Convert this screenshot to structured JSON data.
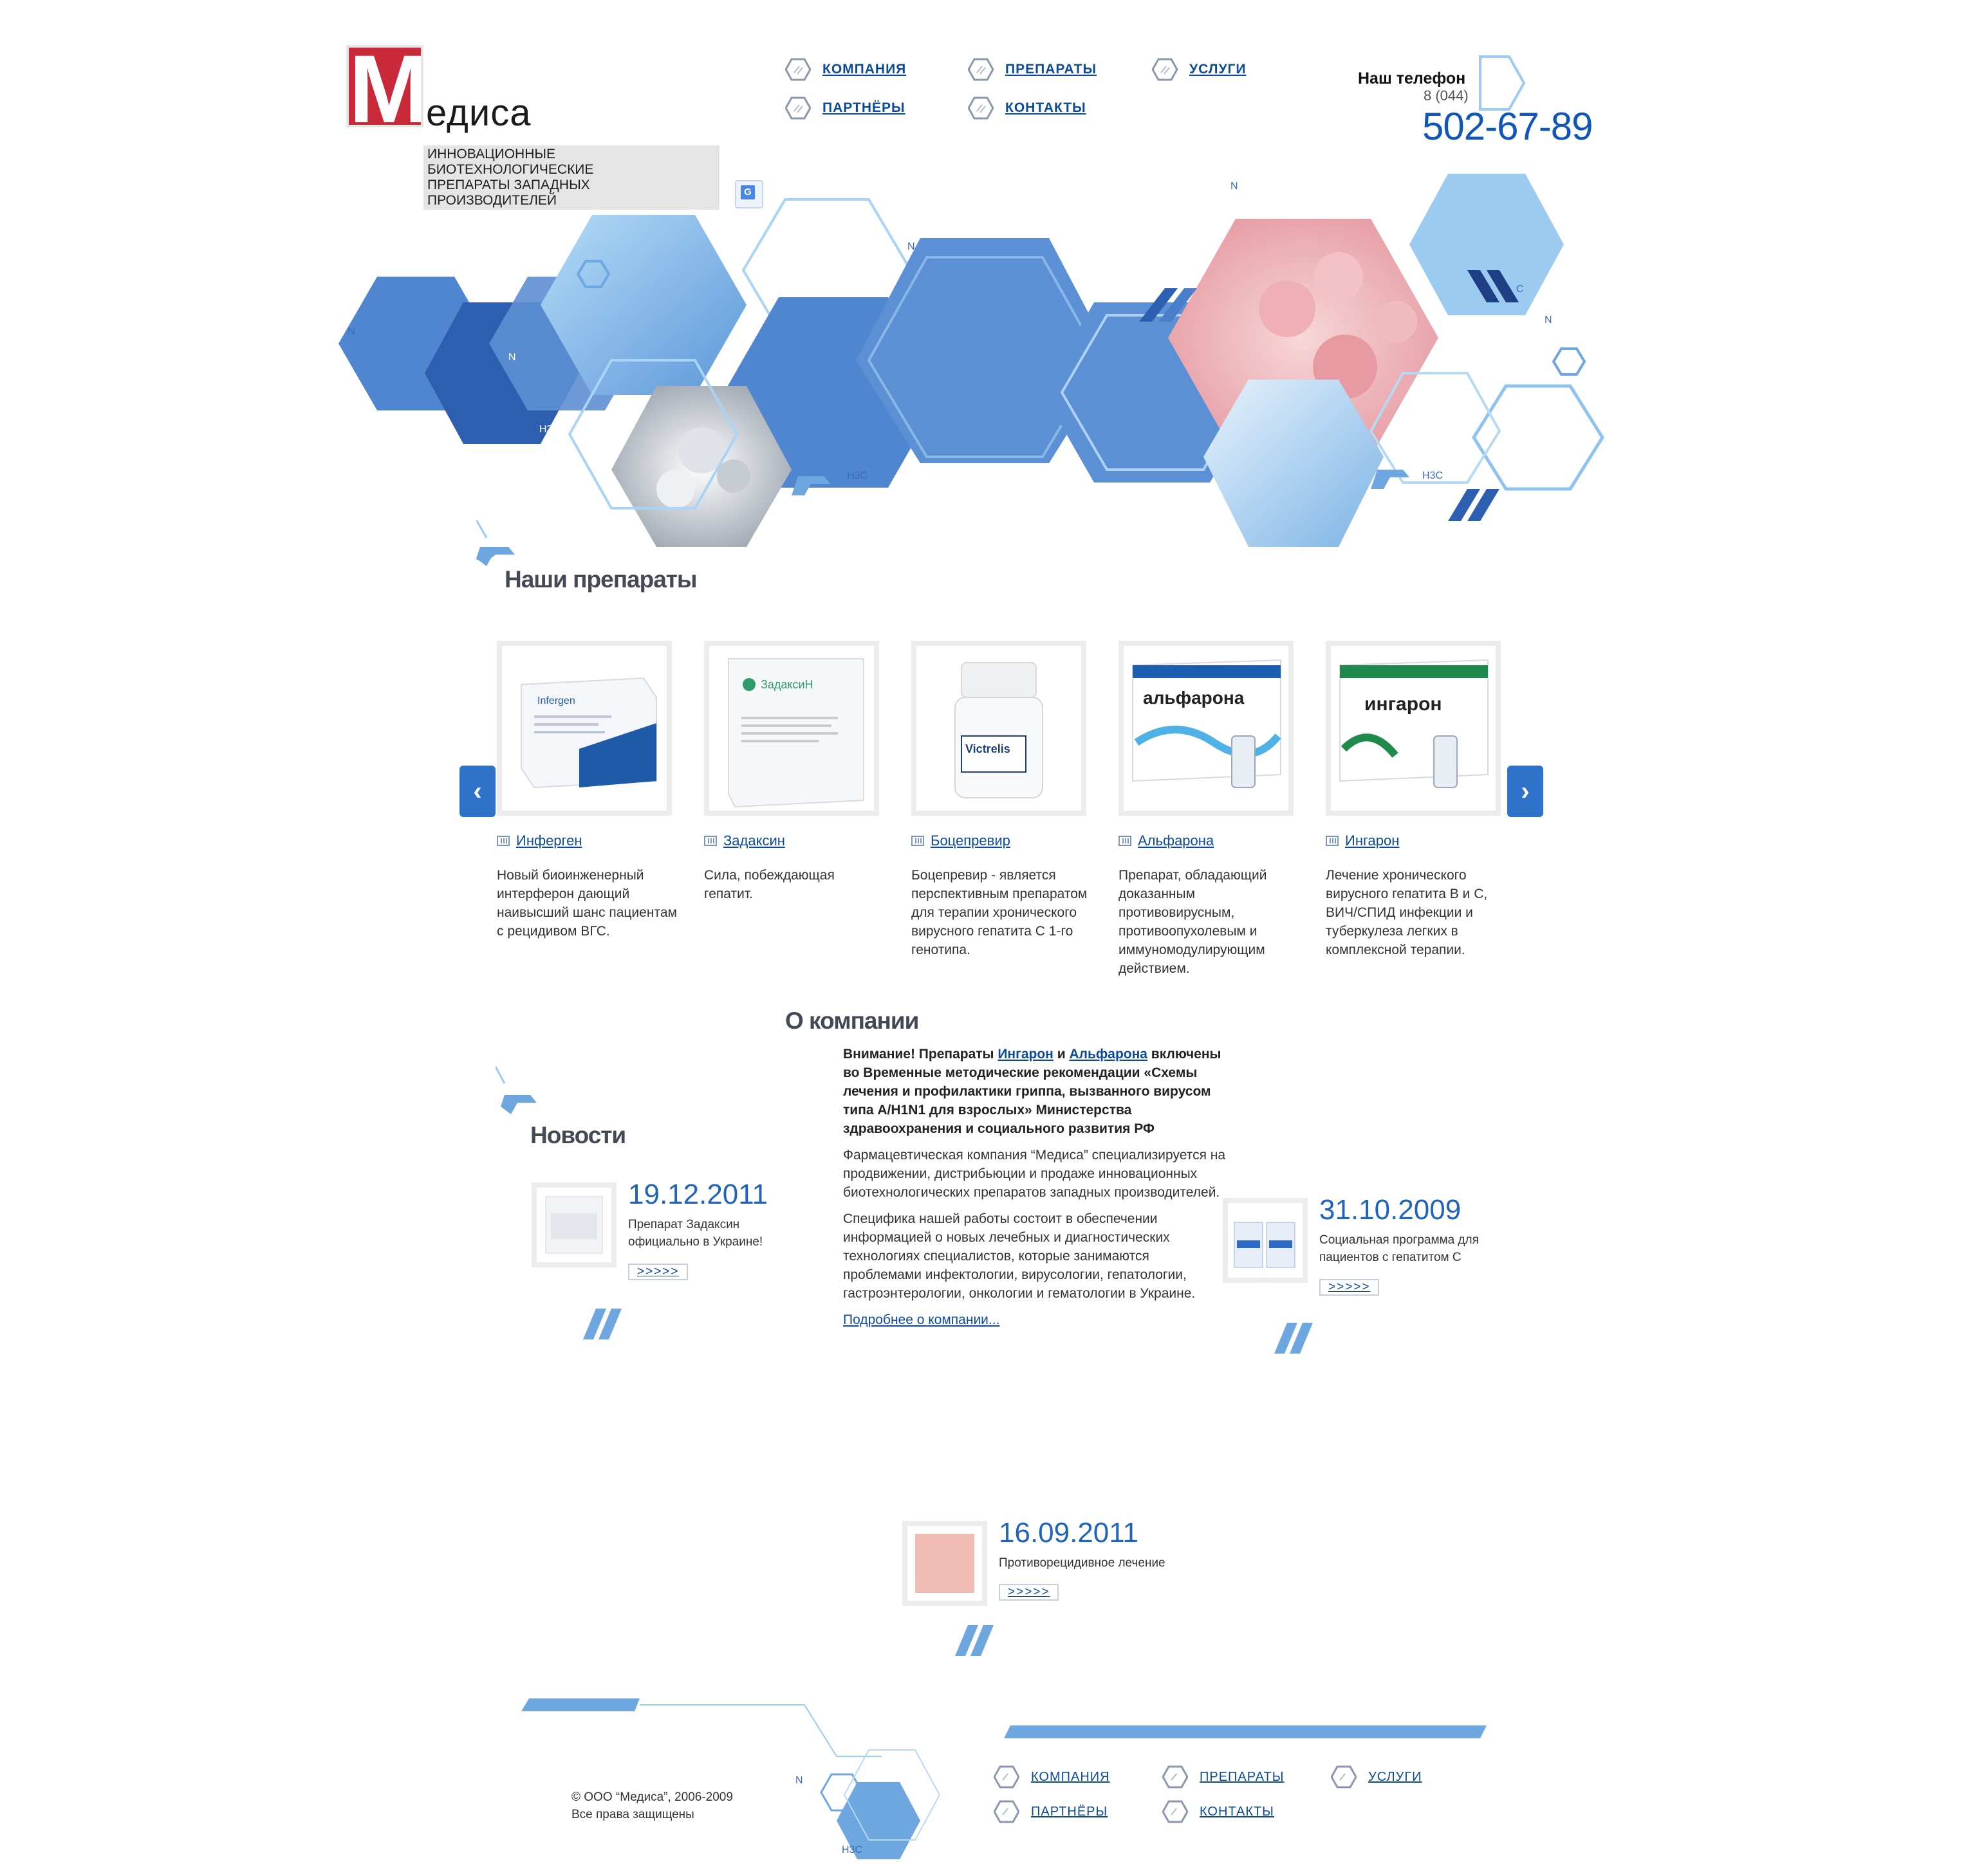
{
  "logo": {
    "letter": "М",
    "name": "едиса",
    "tagline_line1": "Инновационные биотехнологические",
    "tagline_line2": "препараты западных производителей"
  },
  "nav": {
    "items": [
      {
        "label": "КОМПАНИЯ"
      },
      {
        "label": "ПРЕПАРАТЫ"
      },
      {
        "label": "УСЛУГИ"
      },
      {
        "label": "ПАРТНЁРЫ"
      },
      {
        "label": "КОНТАКТЫ"
      }
    ]
  },
  "phone": {
    "label": "Наш телефон",
    "code": "8 (044)",
    "number": "502-67-89"
  },
  "translate_icon": "google-translate-icon",
  "hero": {
    "chem_labels": [
      "N",
      "N",
      "N",
      "H3C",
      "H3C",
      "H3C",
      "N",
      "C",
      "N"
    ]
  },
  "products": {
    "title": "Наши препараты",
    "prev_icon": "chevron-left-icon",
    "next_icon": "chevron-right-icon",
    "items": [
      {
        "name": "Инферген",
        "desc": "Новый биоинженерный интерферон дающий наивысший шанс пациентам с рецидивом ВГС.",
        "box_text": "Infergen",
        "box_color": "#1f5aa8"
      },
      {
        "name": "Задаксин",
        "desc": "Сила, побеждающая гепатит.",
        "box_text": "ЗадаксиН",
        "box_color": "#2d9b6a"
      },
      {
        "name": "Боцепревир",
        "desc": "Боцепревир - является перспективным препаратом для терапии хронического вирусного гепатита С 1-го генотипа.",
        "box_text": "Victrelis",
        "box_color": "#1c3c7a"
      },
      {
        "name": "Альфарона",
        "desc": "Препарат, обладающий доказанным противовирусным, противоопухолевым и иммуномодулирующим действием.",
        "box_text": "альфарона",
        "box_color": "#1c5db0"
      },
      {
        "name": "Ингарон",
        "desc": "Лечение хронического вирусного гепатита В и С, ВИЧ/СПИД инфекции и туберкулеза легких в комплексной терапии.",
        "box_text": "ингарон",
        "box_color": "#1f8a4b"
      }
    ]
  },
  "about": {
    "title": "О компании",
    "notice_pre": "Внимание! Препараты ",
    "notice_link1": "Ингарон",
    "notice_and": " и ",
    "notice_link2": "Альфарона",
    "notice_post": " включены во Временные методические рекомендации «Схемы лечения и профилактики гриппа, вызванного вирусом типа А/H1N1 для взрослых» Министерства здравоохранения и социального развития РФ",
    "para1": "Фармацевтическая компания “Медиса” специализируется на продвижении, дистрибьюции и продаже инновационных биотехнологических препаратов западных производителей.",
    "para2": "Специфика нашей работы состоит в обеспечении информацией о новых лечебных и диагностических технологиях специалистов, которые занимаются проблемами инфектологии, вирусологии, гепатологии, гастроэнтерологии, онкологии и гематологии в Украине.",
    "more_link": "Подробнее о компании..."
  },
  "news": {
    "title": "Новости",
    "items": [
      {
        "date": "19.12.2011",
        "text": "Препарат Задаксин официально в Украине!",
        "more": ">>>>>"
      },
      {
        "date": "31.10.2009",
        "text": "Социальная программа для пациентов с гепатитом С",
        "more": ">>>>>"
      },
      {
        "date": "16.09.2011",
        "text": "Противорецидивное лечение",
        "more": ">>>>>"
      }
    ]
  },
  "footer": {
    "copyright_line1": "© ООО “Медиса”, 2006-2009",
    "copyright_line2": "Все права защищены",
    "nav": [
      {
        "label": "КОМПАНИЯ"
      },
      {
        "label": "ПРЕПАРАТЫ"
      },
      {
        "label": "УСЛУГИ"
      },
      {
        "label": "ПАРТНЁРЫ"
      },
      {
        "label": "КОНТАКТЫ"
      }
    ],
    "chem_labels": [
      "N",
      "H3C"
    ]
  },
  "colors": {
    "accent": "#0f56b8",
    "hex_dark": "#2f62b4",
    "hex_mid": "#5b93d6",
    "hex_light": "#9ccbf2",
    "logo_red": "#c92a3a"
  }
}
